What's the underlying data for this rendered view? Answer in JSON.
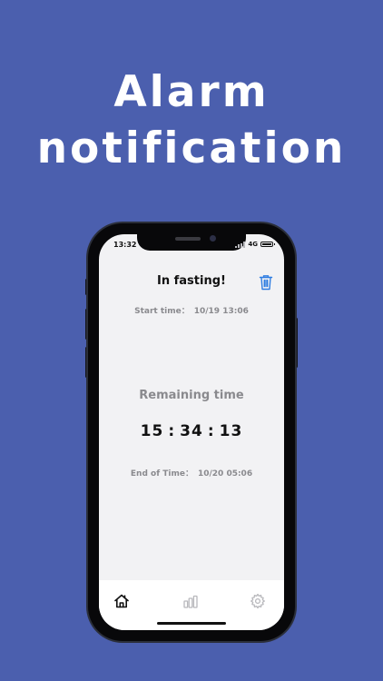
{
  "promo": {
    "headline_line1": "Alarm",
    "headline_line2": "notification",
    "background_color": "#4b5fae"
  },
  "status_bar": {
    "time": "13:32",
    "network": "4G"
  },
  "screen": {
    "title": "In fasting!",
    "start_time_label": "Start time：",
    "start_time_value": "10/19 13:06",
    "remaining_label": "Remaining time",
    "countdown": {
      "hours": "15",
      "minutes": "34",
      "seconds": "13",
      "separator": ":"
    },
    "end_time_label": "End of Time：",
    "end_time_value": "10/20 05:06"
  },
  "tabbar": {
    "items": [
      {
        "icon": "home-icon",
        "active": true
      },
      {
        "icon": "bar-chart-icon",
        "active": false
      },
      {
        "icon": "gear-icon",
        "active": false
      }
    ]
  },
  "colors": {
    "accent": "#2f7de1",
    "muted_text": "#8a8a8e",
    "screen_bg": "#f2f2f4"
  }
}
